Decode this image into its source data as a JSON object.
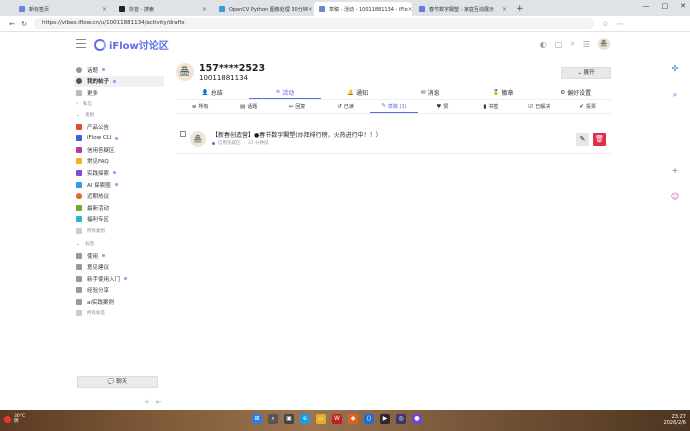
{
  "browser": {
    "tabs": [
      {
        "label": "新标签页",
        "active": false
      },
      {
        "label": "抖音 - 搜索",
        "active": false
      },
      {
        "label": "OpenCV Python 图像处理 30分钟",
        "active": false
      },
      {
        "label": "草稿 - 活动 - 10011881134 - iFlo",
        "active": true
      },
      {
        "label": "春节数字閣塑 - 家庭互动展示",
        "active": false
      }
    ],
    "url": "https://vibex.iflow.cn/u/10011881134/activity/drafts"
  },
  "header": {
    "logo_text": "iFlow讨论区"
  },
  "sidebar": {
    "top_items": [
      {
        "label": "话题",
        "dot": true,
        "active": false,
        "icon_color": "#888"
      },
      {
        "label": "我的帖子",
        "dot": true,
        "active": true,
        "icon_color": "#555"
      },
      {
        "label": "更多",
        "dot": false,
        "active": false,
        "icon_color": "#888"
      }
    ],
    "section_private": "私信",
    "section_categories": "类别",
    "categories": [
      {
        "label": "产品公告",
        "color": "#e04a3a",
        "dot": false
      },
      {
        "label": "iFlow CLI",
        "color": "#3a5fe0",
        "dot": true
      },
      {
        "label": "信用答疑区",
        "color": "#c03b8f",
        "dot": false
      },
      {
        "label": "常见FAQ",
        "color": "#f0b320",
        "dot": false
      },
      {
        "label": "实践探索",
        "color": "#7d4dd8",
        "dot": true
      },
      {
        "label": "AI 探索圈",
        "color": "#2f9be0",
        "dot": true
      },
      {
        "label": "近期热议",
        "color": "#e06a2a",
        "dot": false
      },
      {
        "label": "最新活动",
        "color": "#6aa830",
        "dot": false
      },
      {
        "label": "福利专区",
        "color": "#2ab5d8",
        "dot": false
      }
    ],
    "all_categories": "所有类别",
    "section_tags": "标签",
    "tags": [
      {
        "label": "使用",
        "dot": true
      },
      {
        "label": "意见建议",
        "dot": false
      },
      {
        "label": "新手使用入门",
        "dot": true
      },
      {
        "label": "经验分享",
        "dot": false
      },
      {
        "label": "ai实践案例",
        "dot": false
      }
    ],
    "all_tags": "所有标签",
    "chat_button": "聊天"
  },
  "profile": {
    "name": "157****2523",
    "id": "10011881134",
    "expand_label": "展开"
  },
  "primary_tabs": [
    {
      "label": "总结",
      "icon": "user-icon",
      "active": false
    },
    {
      "label": "活动",
      "icon": "stream-icon",
      "active": true
    },
    {
      "label": "通知",
      "icon": "bell-icon",
      "active": false
    },
    {
      "label": "消息",
      "icon": "envelope-icon",
      "active": false
    },
    {
      "label": "徽章",
      "icon": "badge-icon",
      "active": false
    },
    {
      "label": "偏好设置",
      "icon": "gear-icon",
      "active": false
    }
  ],
  "secondary_tabs": [
    {
      "label": "所有",
      "icon": "list-icon",
      "active": false
    },
    {
      "label": "话题",
      "icon": "topic-icon",
      "active": false
    },
    {
      "label": "回复",
      "icon": "reply-icon",
      "active": false
    },
    {
      "label": "已读",
      "icon": "history-icon",
      "active": false
    },
    {
      "label": "草稿 (1)",
      "icon": "pencil-icon",
      "active": true
    },
    {
      "label": "赞",
      "icon": "heart-icon",
      "active": false
    },
    {
      "label": "书签",
      "icon": "bookmark-icon",
      "active": false
    },
    {
      "label": "已解决",
      "icon": "check-icon",
      "active": false
    },
    {
      "label": "投票",
      "icon": "vote-icon",
      "active": false
    }
  ],
  "draft": {
    "title": "【新春创造营】●春节数字閣塑(炒拜排行榜，火热进行中！！）",
    "category": "信用答疑区",
    "time": "37 分钟前"
  },
  "taskbar": {
    "weather_temp": "30°C",
    "weather_desc": "阴",
    "time": "23:27",
    "date": "2026/2/6"
  }
}
